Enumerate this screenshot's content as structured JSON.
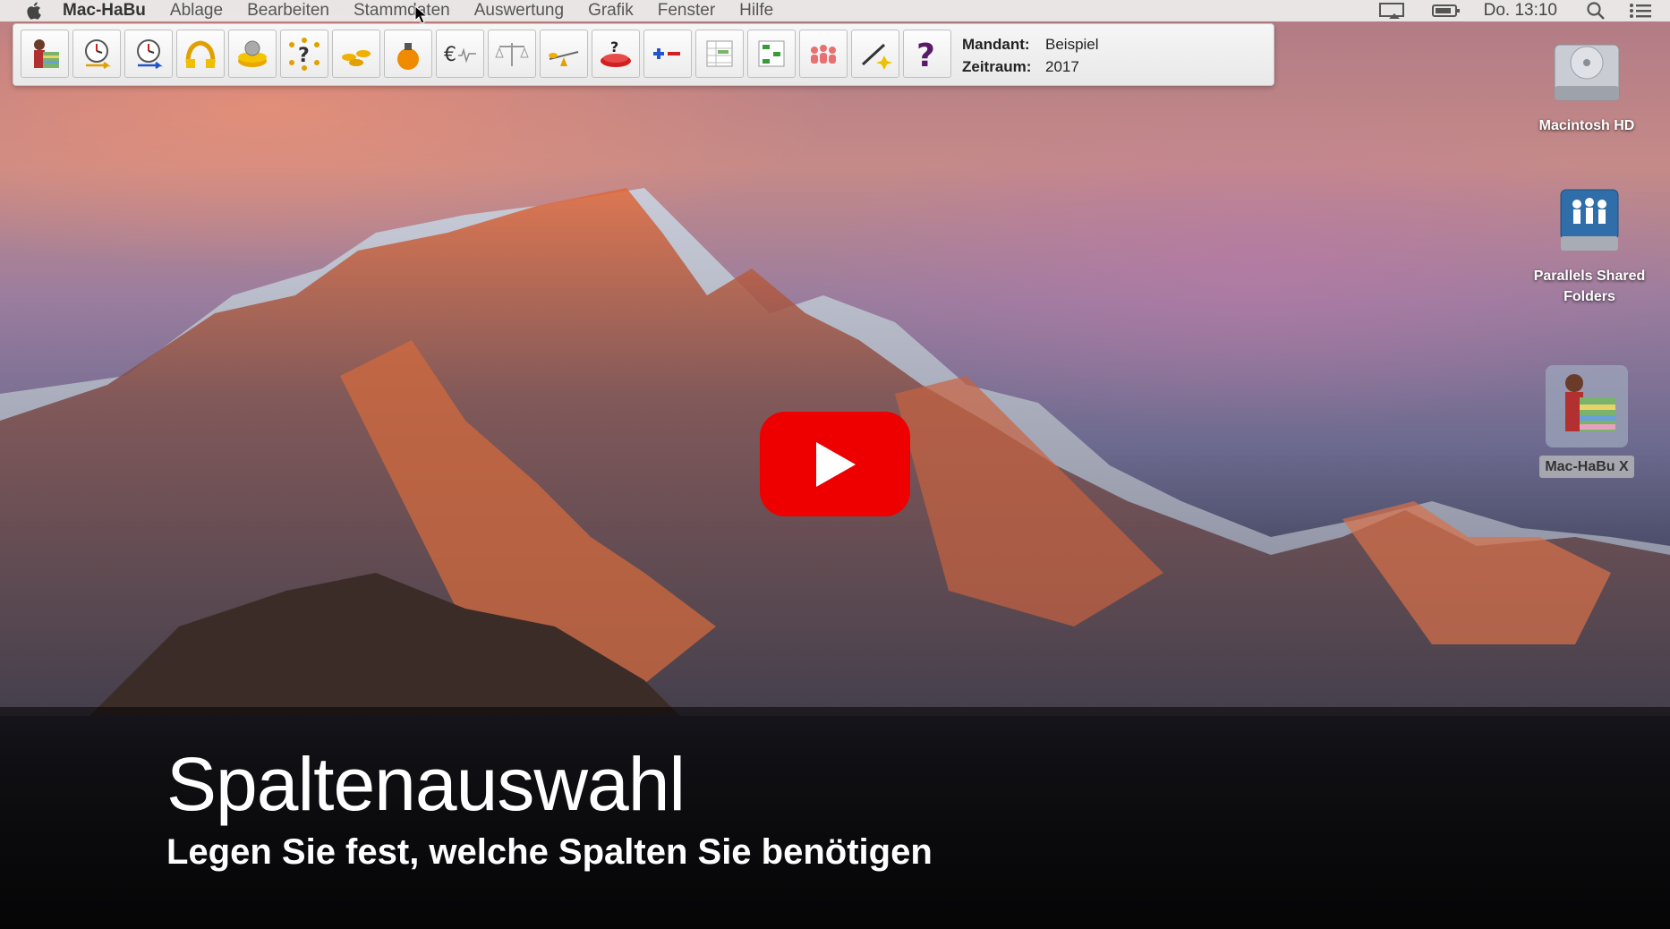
{
  "menubar": {
    "app_name": "Mac-HaBu",
    "menus": [
      "Ablage",
      "Bearbeiten",
      "Stammdaten",
      "Auswertung",
      "Grafik",
      "Fenster",
      "Hilfe"
    ],
    "clock": "Do. 13:10",
    "icons": [
      "apple-icon",
      "display-icon",
      "battery-icon",
      "search-icon",
      "list-icon"
    ]
  },
  "toolbar": {
    "buttons": [
      {
        "name": "habu-user-icon"
      },
      {
        "name": "clock-in-icon"
      },
      {
        "name": "clock-out-icon"
      },
      {
        "name": "money-bag-icon"
      },
      {
        "name": "coin-pot-icon"
      },
      {
        "name": "question-dots-icon"
      },
      {
        "name": "coins-icon"
      },
      {
        "name": "orange-bag-icon"
      },
      {
        "name": "euro-wave-icon"
      },
      {
        "name": "scale-icon"
      },
      {
        "name": "seesaw-icon"
      },
      {
        "name": "red-question-icon"
      },
      {
        "name": "plus-minus-icon"
      },
      {
        "name": "table-icon"
      },
      {
        "name": "tree-icon"
      },
      {
        "name": "people-icon"
      },
      {
        "name": "pen-spark-icon"
      },
      {
        "name": "help-question-icon"
      }
    ],
    "mandant_label": "Mandant:",
    "mandant_value": "Beispiel",
    "zeitraum_label": "Zeitraum:",
    "zeitraum_value": "2017"
  },
  "desktop": {
    "icons": [
      {
        "label": "Macintosh HD"
      },
      {
        "label": "Parallels Shared Folders"
      },
      {
        "label": "Mac-HaBu X"
      }
    ]
  },
  "caption": {
    "title": "Spaltenauswahl",
    "subtitle": "Legen Sie fest, welche Spalten Sie benötigen"
  },
  "colors": {
    "play_red": "#ee0000"
  }
}
